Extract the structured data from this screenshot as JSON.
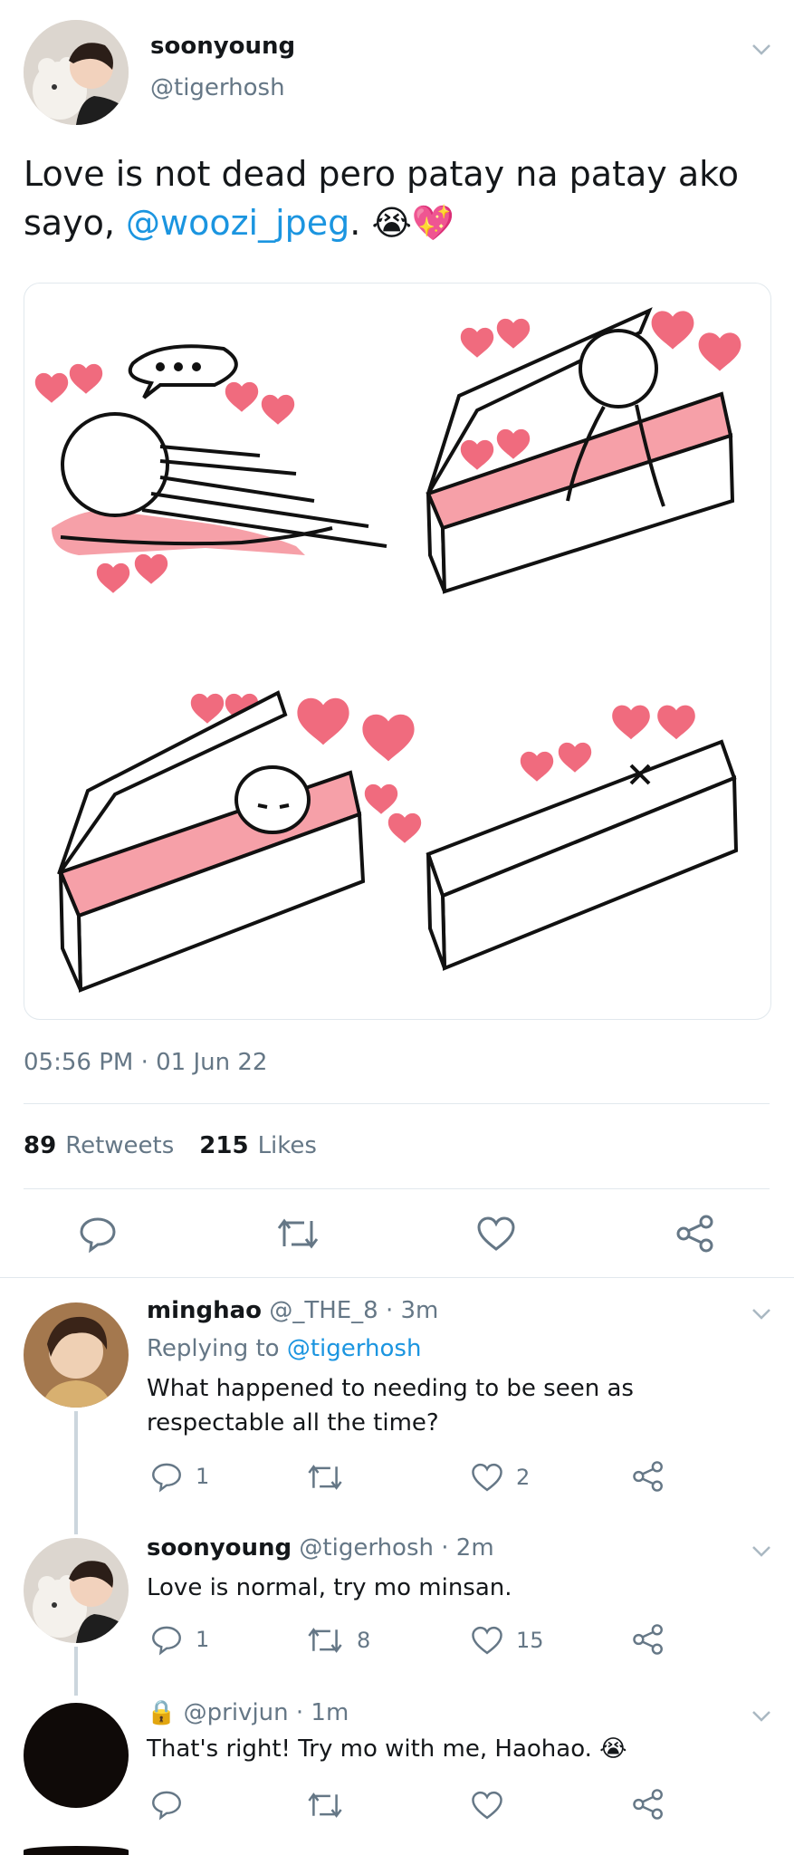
{
  "tweet": {
    "display_name": "soonyoung",
    "handle": "@tigerhosh",
    "text_main": "Love is not dead pero patay na patay ako sayo,",
    "mention": "@woozi_jpeg",
    "text_end": ".",
    "emojis": "😭💖",
    "timestamp": "05:56 PM · 01 Jun 22",
    "retweets_count": "89",
    "retweets_label": "Retweets",
    "likes_count": "215",
    "likes_label": "Likes"
  },
  "replies": [
    {
      "display_name": "minghao",
      "handle": "@_THE_8",
      "time": "· 3m",
      "replying_prefix": "Replying to",
      "replying_to": "@tigerhosh",
      "text": "What happened to needing to be seen as respectable all the time?",
      "reply_count": "1",
      "retweet_count": "",
      "like_count": "2"
    },
    {
      "display_name": "soonyoung",
      "handle": "@tigerhosh",
      "time": "· 2m",
      "text": "Love is normal, try mo minsan.",
      "reply_count": "1",
      "retweet_count": "8",
      "like_count": "15"
    },
    {
      "display_name": "",
      "lock": "🔒",
      "handle": "@privjun",
      "time": "· 1m",
      "text": "That's right! Try mo with me, Haohao. 😭",
      "reply_count": "",
      "retweet_count": "",
      "like_count": ""
    }
  ],
  "icons": [
    "chevron-down-icon",
    "reply-icon",
    "retweet-icon",
    "like-icon",
    "share-icon",
    "lock-icon"
  ],
  "colors": {
    "accent": "#1b95e0",
    "secondary": "#657786",
    "divider": "#e1e8ed",
    "heart": "#f06b7e"
  }
}
